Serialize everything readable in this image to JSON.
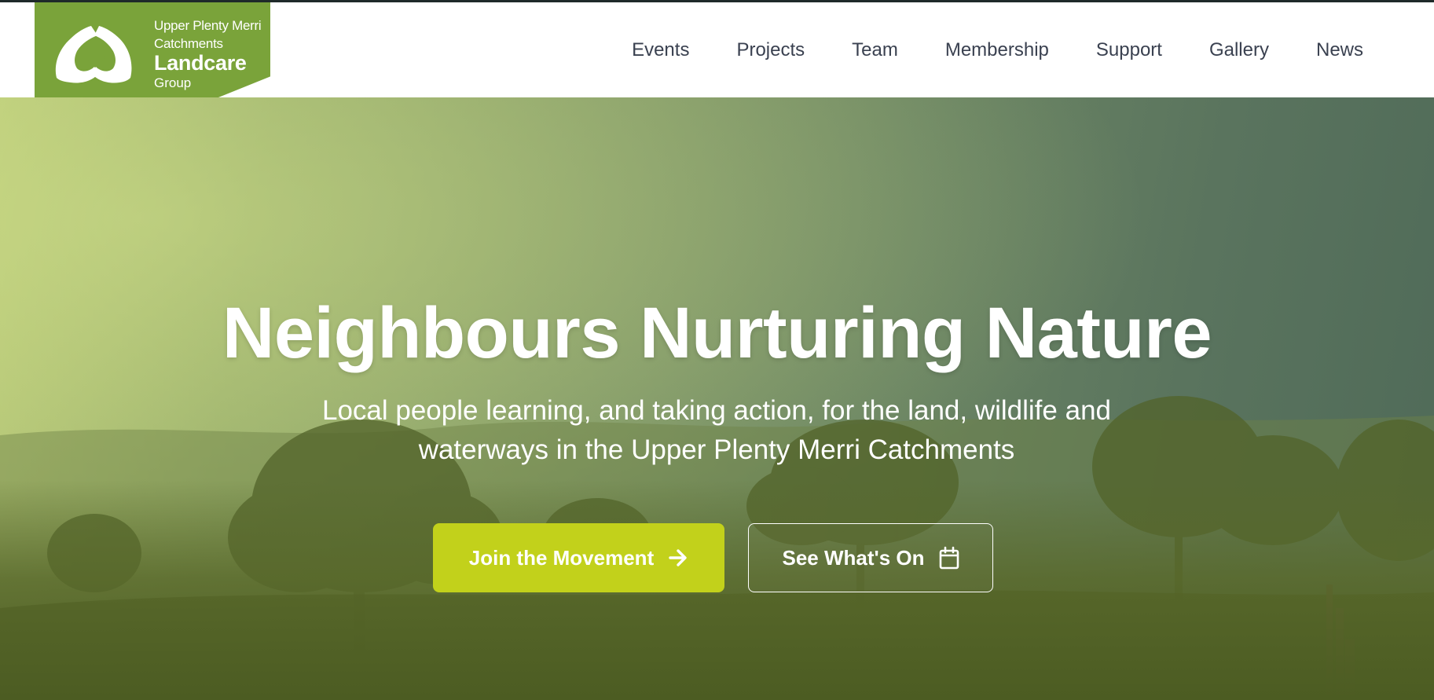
{
  "brand": {
    "line1": "Upper Plenty Merri",
    "line2": "Catchments",
    "line3": "Landcare",
    "line4": "Group",
    "color": "#7aa33a",
    "icon": "hands-australia-icon"
  },
  "nav": {
    "items": [
      {
        "label": "Events"
      },
      {
        "label": "Projects"
      },
      {
        "label": "Team"
      },
      {
        "label": "Membership"
      },
      {
        "label": "Support"
      },
      {
        "label": "Gallery"
      },
      {
        "label": "News"
      }
    ]
  },
  "hero": {
    "title": "Neighbours Nurturing Nature",
    "subtitle": "Local people learning, and taking action, for the land, wildlife and waterways in the Upper Plenty Merri Catchments",
    "primary_button": {
      "label": "Join the Movement",
      "icon": "arrow-right-icon",
      "color": "#c2d11b"
    },
    "secondary_button": {
      "label": "See What's On",
      "icon": "calendar-icon"
    }
  }
}
